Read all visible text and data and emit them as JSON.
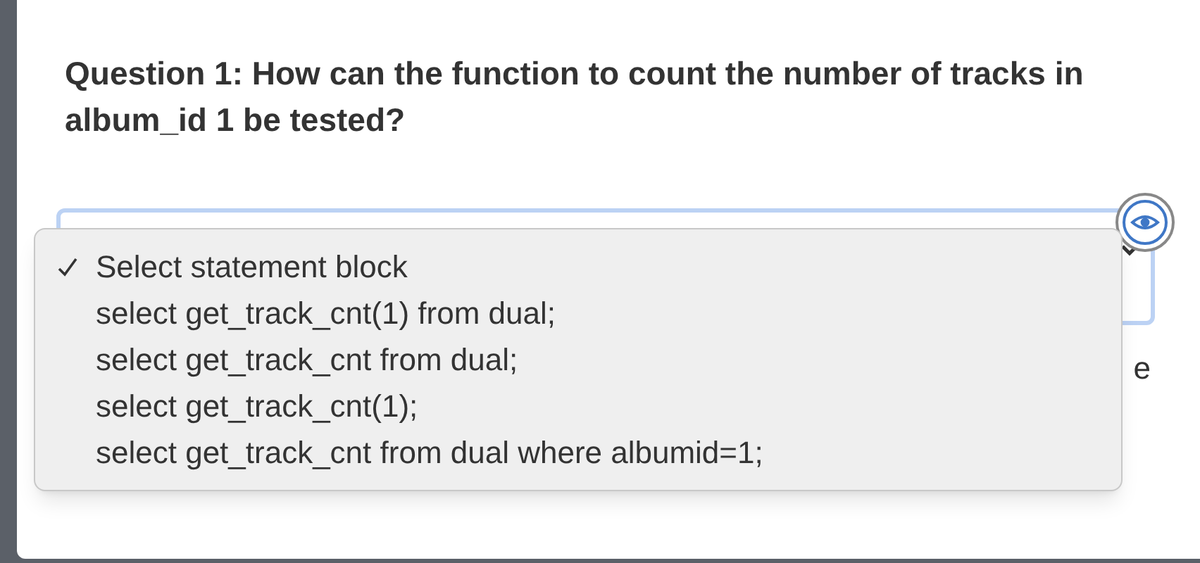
{
  "question": {
    "title": "Question 1: How can the function to count the number of tracks in album_id 1 be tested?"
  },
  "dropdown": {
    "options": [
      {
        "label": "Select statement block",
        "selected": true
      },
      {
        "label": "select get_track_cnt(1) from dual;",
        "selected": false
      },
      {
        "label": "select get_track_cnt from dual;",
        "selected": false
      },
      {
        "label": "select get_track_cnt(1);",
        "selected": false
      },
      {
        "label": "select get_track_cnt from dual where albumid=1;",
        "selected": false
      }
    ]
  },
  "hidden_text": "e"
}
